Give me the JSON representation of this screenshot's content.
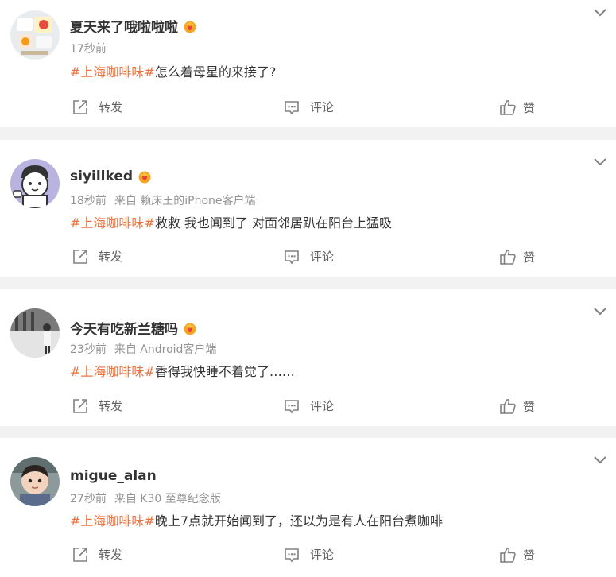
{
  "colors": {
    "tag": "#eb7340",
    "meta": "#939393",
    "action": "#636363",
    "vip_badge": "#f5a623"
  },
  "posts": [
    {
      "username": "夏天来了哦啦啦啦",
      "time": "17秒前",
      "source": "",
      "hashtag": "#上海咖啡味#",
      "content": "怎么着母星的来接了?",
      "avatar_icon": "food-photo-avatar",
      "actions": {
        "repost": "转发",
        "comment": "评论",
        "like": "赞"
      }
    },
    {
      "username": "siyillked",
      "time": "18秒前",
      "source": "来自 赖床王的iPhone客户端",
      "hashtag": "#上海咖啡味#",
      "content": "救救 我也闻到了 对面邻居趴在阳台上猛吸",
      "avatar_icon": "cartoon-avatar",
      "actions": {
        "repost": "转发",
        "comment": "评论",
        "like": "赞"
      }
    },
    {
      "username": "今天有吃新兰糖吗",
      "time": "23秒前",
      "source": "来自 Android客户端",
      "hashtag": "#上海咖啡味#",
      "content": "香得我快睡不着觉了……",
      "avatar_icon": "bw-photo-avatar",
      "actions": {
        "repost": "转发",
        "comment": "评论",
        "like": "赞"
      }
    },
    {
      "username": "migue_alan",
      "time": "27秒前",
      "source": "来自 K30 至尊纪念版",
      "hashtag": "#上海咖啡味#",
      "content": "晚上7点就开始闻到了，还以为是有人在阳台煮咖啡",
      "avatar_icon": "child-photo-avatar",
      "actions": {
        "repost": "转发",
        "comment": "评论",
        "like": "赞"
      }
    }
  ]
}
